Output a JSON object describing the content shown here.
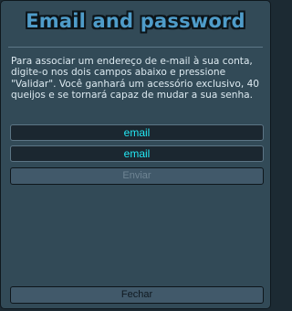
{
  "dialog": {
    "title": "Email and password",
    "description": "Para associar um endereço de e-mail à sua conta, digite-o nos dois campos abaixo e pressione \"Validar\". Você ganhará um acessório exclusivo, 40 queijos e se tornará capaz de mudar a sua senha.",
    "email_field_1": {
      "value": "email"
    },
    "email_field_2": {
      "value": "email"
    },
    "send_label": "Enviar",
    "close_label": "Fechar"
  },
  "colors": {
    "panel": "#324a57",
    "title": "#4f9cc9",
    "input_text": "#23e8f4",
    "button": "#41596a"
  }
}
